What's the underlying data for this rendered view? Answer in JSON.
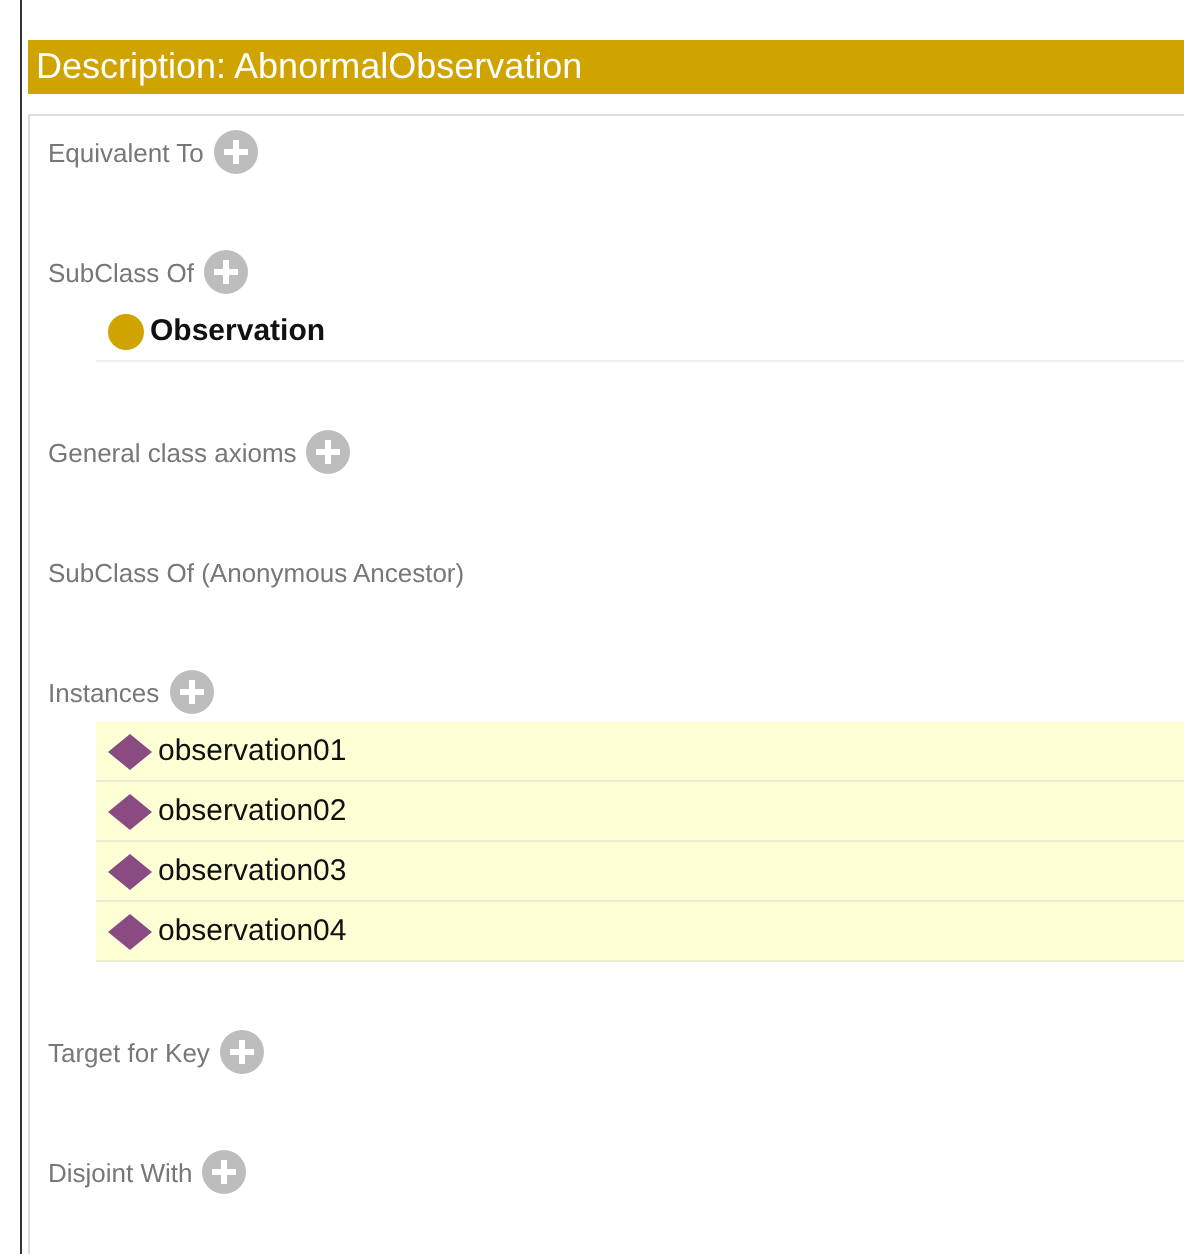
{
  "header": {
    "title": "Description: AbnormalObservation"
  },
  "sections": [
    {
      "title": "Equivalent To",
      "add_button": true
    },
    {
      "title": "SubClass Of",
      "add_button": true,
      "items": [
        {
          "kind": "class",
          "label": "Observation"
        }
      ]
    },
    {
      "title": "General class axioms",
      "add_button": true
    },
    {
      "title": "SubClass Of (Anonymous Ancestor)",
      "add_button": false
    },
    {
      "title": "Instances",
      "add_button": true,
      "items": [
        {
          "kind": "individual",
          "label": "observation01"
        },
        {
          "kind": "individual",
          "label": "observation02"
        },
        {
          "kind": "individual",
          "label": "observation03"
        },
        {
          "kind": "individual",
          "label": "observation04"
        }
      ]
    },
    {
      "title": "Target for Key",
      "add_button": true
    },
    {
      "title": "Disjoint With",
      "add_button": true
    }
  ]
}
